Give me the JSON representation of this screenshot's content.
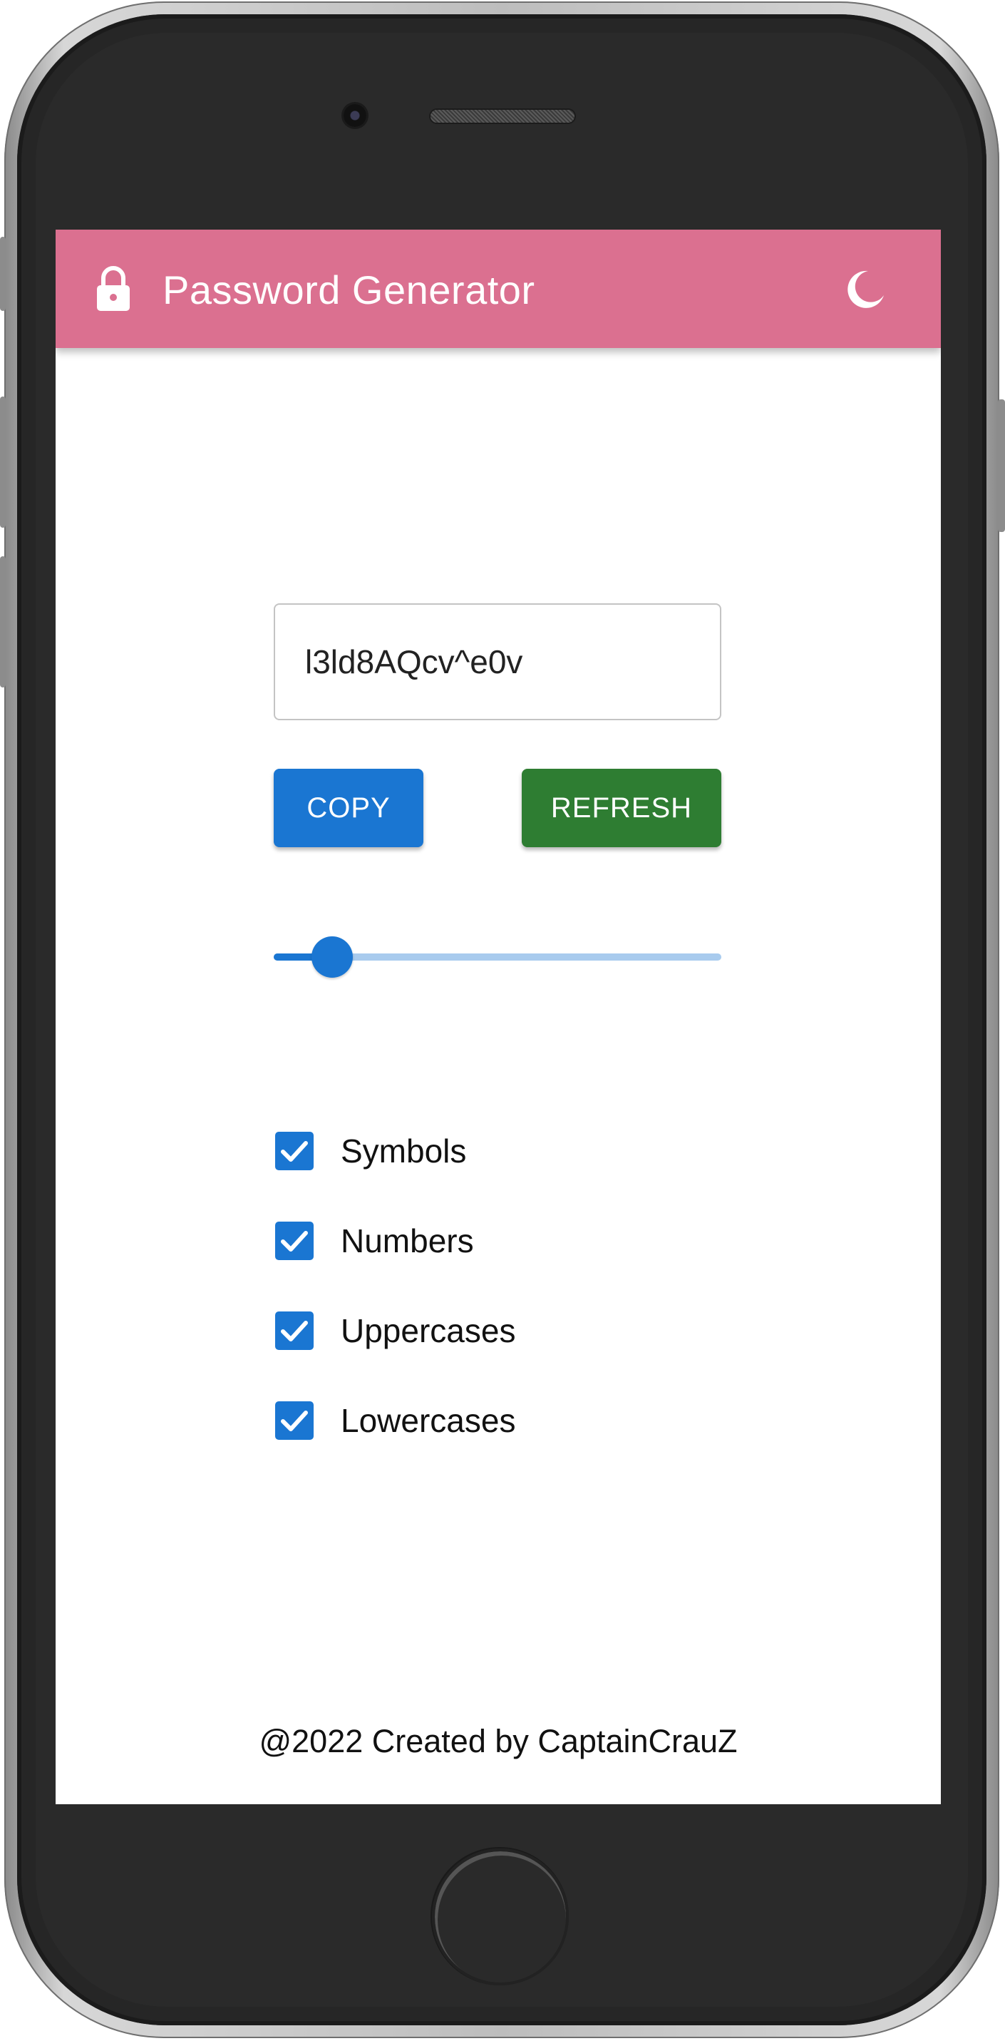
{
  "app_bar": {
    "title": "Password Generator",
    "lock_icon": "lock-icon",
    "theme_icon": "moon-icon",
    "background": "#db7090"
  },
  "password": {
    "value": "l3ld8AQcv^e0v"
  },
  "actions": {
    "copy_label": "COPY",
    "refresh_label": "REFRESH",
    "copy_color": "#1a76d2",
    "refresh_color": "#2e7d32"
  },
  "length_slider": {
    "fraction": 0.13
  },
  "options": [
    {
      "label": "Symbols",
      "checked": true
    },
    {
      "label": "Numbers",
      "checked": true
    },
    {
      "label": "Uppercases",
      "checked": true
    },
    {
      "label": "Lowercases",
      "checked": true
    }
  ],
  "footer": {
    "text": "@2022 Created by CaptainCrauZ"
  }
}
